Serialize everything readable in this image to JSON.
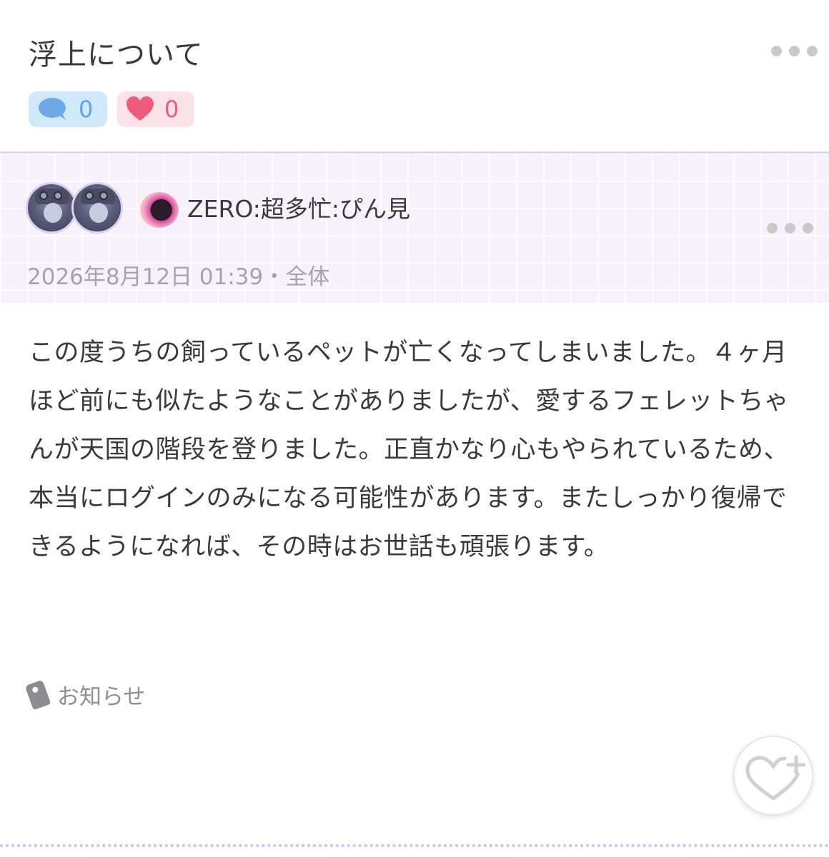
{
  "post": {
    "title": "浮上について",
    "comment_count": "0",
    "like_count": "0",
    "author": {
      "name": "ZERO:超多忙:ぴん見"
    },
    "meta": "2026年8月12日 01:39・全体",
    "body": "この度うちの飼っているペットが亡くなってしまいました。４ヶ月ほど前にも似たようなことがありましたが、愛するフェレットちゃんが天国の階段を登りました。正直かなり心もやられているため、本当にログインのみになる可能性があります。またしっかり復帰できるようになれば、その時はお世話も頑張ります。",
    "tag": "お知らせ"
  },
  "icons": {
    "more": "more-dots-icon",
    "comment": "speech-bubble-icon",
    "like": "heart-icon",
    "tag": "tag-icon",
    "like_add": "heart-plus-icon"
  },
  "colors": {
    "comment_accent": "#5aa6e6",
    "like_accent": "#ee5b7a",
    "band_bg": "#f6f1fb"
  }
}
